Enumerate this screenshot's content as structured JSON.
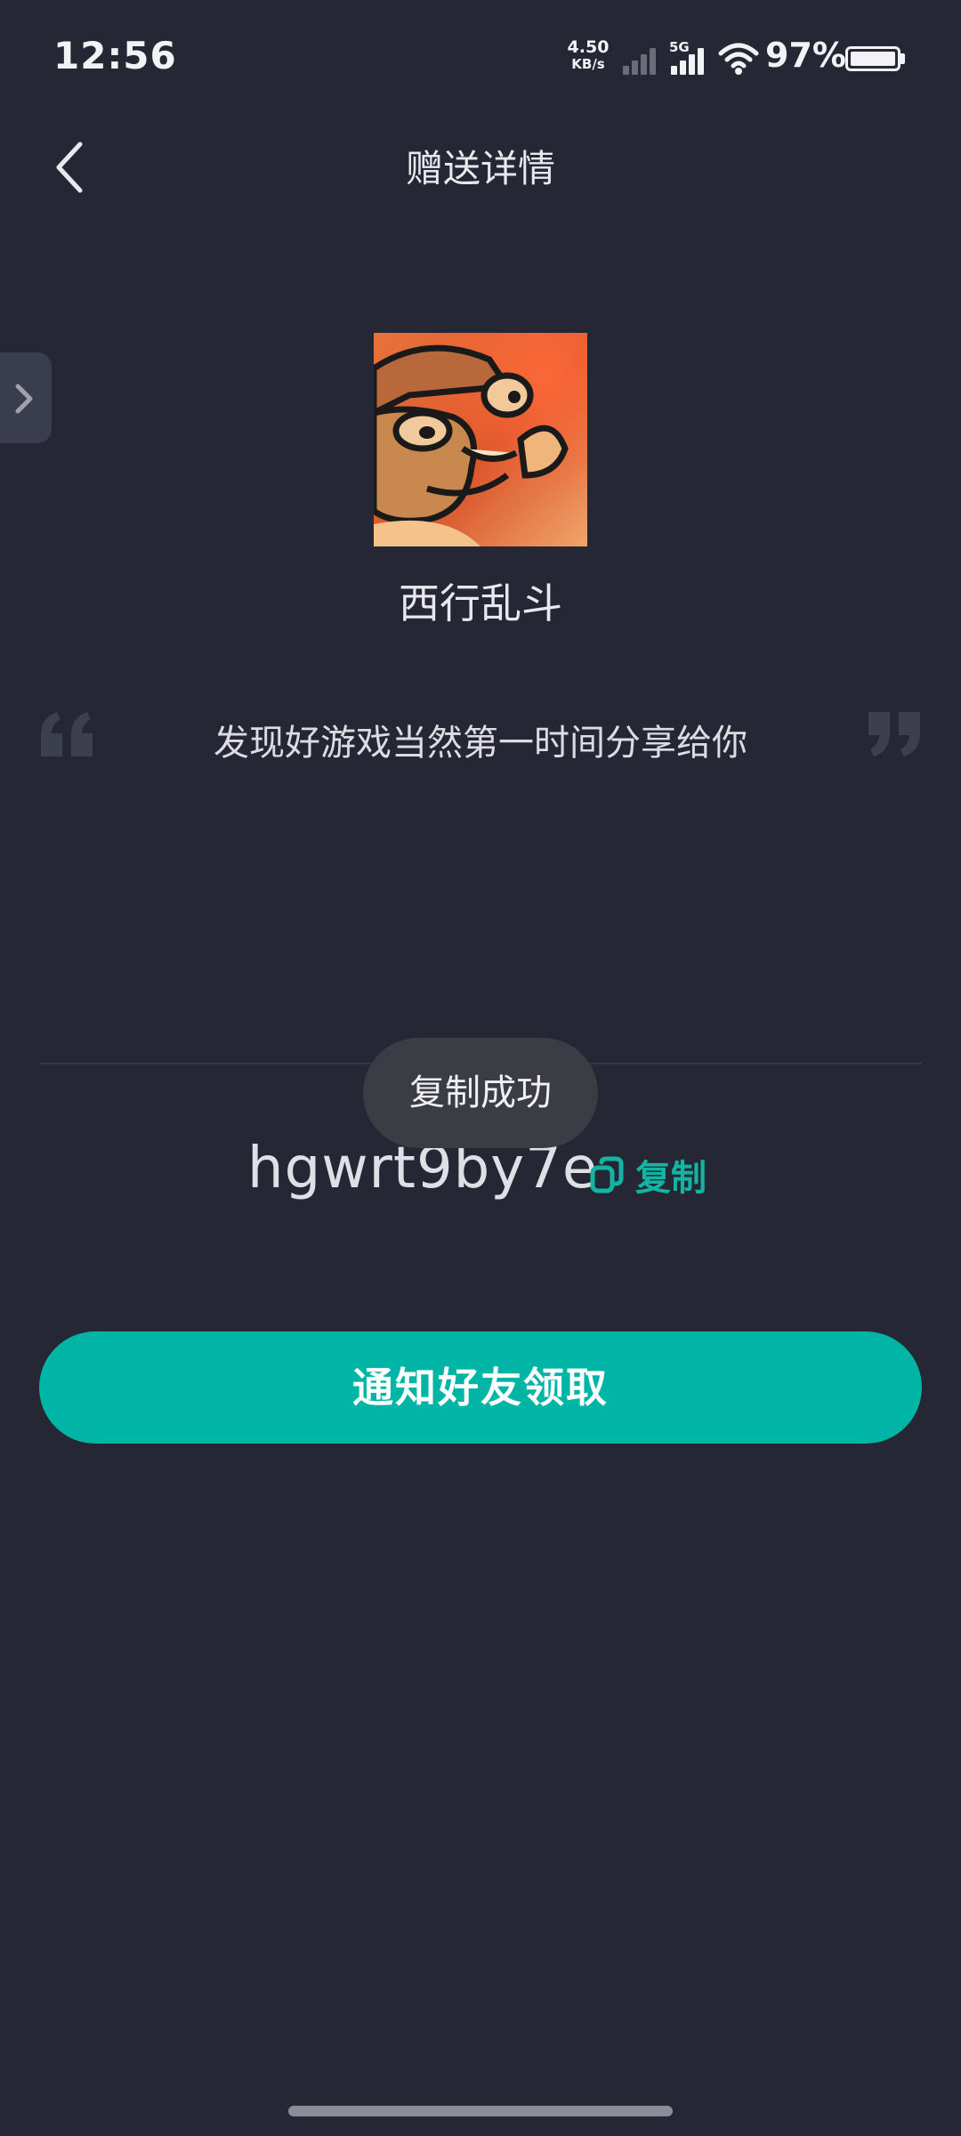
{
  "status_bar": {
    "time": "12:56",
    "net_speed_value": "4.50",
    "net_speed_unit": "KB/s",
    "network_type": "5G",
    "battery_percent": "97%",
    "battery_level": 0.97
  },
  "header": {
    "title": "赠送详情"
  },
  "game": {
    "name": "西行乱斗"
  },
  "message": "发现好游戏当然第一时间分享给你",
  "gift_code": {
    "code": "hgwrt9by7e",
    "copy_label": "复制"
  },
  "toast": "复制成功",
  "notify_button": "通知好友领取",
  "colors": {
    "background": "#252734",
    "accent": "#00b5a5",
    "accent_text": "#12b5a4"
  }
}
